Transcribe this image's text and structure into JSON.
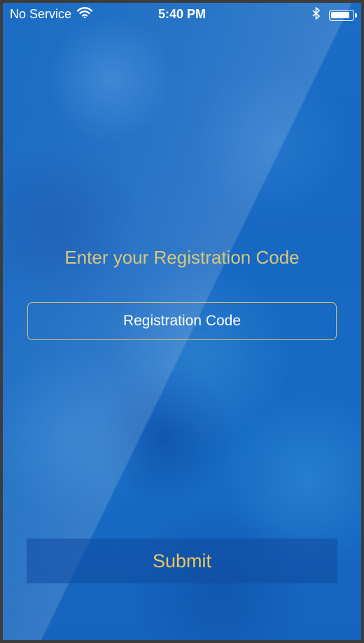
{
  "status_bar": {
    "carrier": "No Service",
    "time": "5:40 PM",
    "wifi_icon": "wifi-icon",
    "bluetooth_icon": "bluetooth-icon",
    "battery_icon": "battery-icon"
  },
  "main": {
    "prompt": "Enter your Registration Code",
    "registration_field": {
      "placeholder": "Registration Code",
      "value": ""
    },
    "submit_label": "Submit"
  },
  "colors": {
    "background": "#1a6cc4",
    "prompt_text": "#d8c77a",
    "field_border": "#cdbd79",
    "submit_text": "#eec560"
  }
}
